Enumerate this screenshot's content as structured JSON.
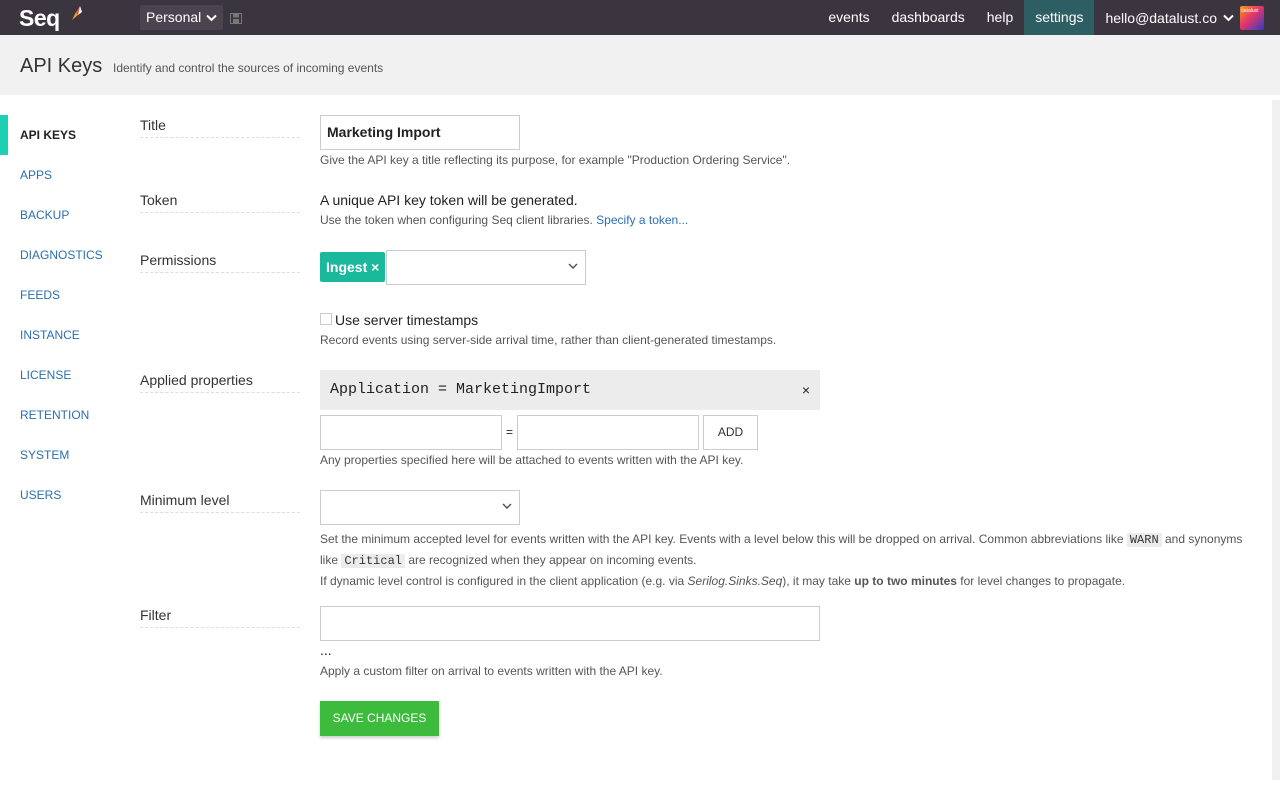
{
  "app": {
    "name": "Seq"
  },
  "workspace": {
    "label": "Personal"
  },
  "nav": {
    "events": "events",
    "dashboards": "dashboards",
    "help": "help",
    "settings": "settings",
    "user": "hello@datalust.co",
    "avatar_text": "datalust"
  },
  "header": {
    "title": "API Keys",
    "subtitle": "Identify and control the sources of incoming events"
  },
  "sidebar": {
    "items": [
      {
        "label": "API KEYS"
      },
      {
        "label": "APPS"
      },
      {
        "label": "BACKUP"
      },
      {
        "label": "DIAGNOSTICS"
      },
      {
        "label": "FEEDS"
      },
      {
        "label": "INSTANCE"
      },
      {
        "label": "LICENSE"
      },
      {
        "label": "RETENTION"
      },
      {
        "label": "SYSTEM"
      },
      {
        "label": "USERS"
      }
    ]
  },
  "form": {
    "title": {
      "label": "Title",
      "value": "Marketing Import",
      "help": "Give the API key a title reflecting its purpose, for example \"Production Ordering Service\"."
    },
    "token": {
      "label": "Token",
      "text": "A unique API key token will be generated.",
      "help": "Use the token when configuring Seq client libraries.",
      "link": "Specify a token..."
    },
    "permissions": {
      "label": "Permissions",
      "tag": "Ingest",
      "tag_remove": "×",
      "server_timestamps_label": "Use server timestamps",
      "server_timestamps_help": "Record events using server-side arrival time, rather than client-generated timestamps."
    },
    "applied_properties": {
      "label": "Applied properties",
      "existing": "Application = MarketingImport",
      "remove": "×",
      "equals": "=",
      "add_label": "ADD",
      "help": "Any properties specified here will be attached to events written with the API key."
    },
    "minimum_level": {
      "label": "Minimum level",
      "help_1a": "Set the minimum accepted level for events written with the API key. Events with a level below this will be dropped on arrival. Common abbreviations like",
      "code_warn": "WARN",
      "help_1b": "and synonyms",
      "help_2a": "like",
      "code_critical": "Critical",
      "help_2b": "are recognized when they appear on incoming events.",
      "help_3a": "If dynamic level control is configured in the client application (e.g. via",
      "help_3_em": "Serilog.Sinks.Seq",
      "help_3b": "), it may take",
      "help_3_strong": "up to two minutes",
      "help_3c": "for level changes to propagate."
    },
    "filter": {
      "label": "Filter",
      "ellipsis": "...",
      "help": "Apply a custom filter on arrival to events written with the API key."
    },
    "save_label": "SAVE CHANGES"
  },
  "colors": {
    "topbar": "#3b3540",
    "active_nav": "#2d5e63",
    "accent": "#1ed0b3",
    "tag": "#1ab99d",
    "save": "#3dbb3d",
    "link": "#2a6fb0"
  }
}
